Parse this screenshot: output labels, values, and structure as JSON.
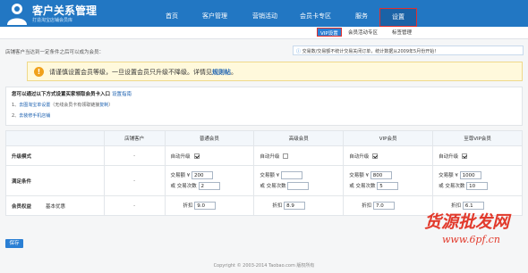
{
  "brand": {
    "title": "客户关系管理",
    "subtitle": "打造淘宝店铺会员库"
  },
  "nav": {
    "items": [
      "首页",
      "客户管理",
      "营销活动",
      "会员卡专区",
      "服务",
      "设置"
    ]
  },
  "subnav": {
    "items": [
      "VIP设置",
      "会员活动专区",
      "标签管理"
    ]
  },
  "intro": "店铺客户当达到一定条件之后可以成为会员：",
  "notice": {
    "text": "交易数/交易额不统计交易关闭订单，统计数据从2009年5月份开始！",
    "link": ""
  },
  "warning": {
    "text": "请谨慎设置会员等级，一旦设置会员只升级不降级。详情见",
    "link": "规则帖",
    "tail": "。"
  },
  "guide": {
    "title": "您可以通过以下方式设置买家领取会员卡入口",
    "title_link": "设置指南",
    "step1_prefix": "1、",
    "step1_link": "去图淘宝单设置",
    "step1_text": "（无线会员卡有领取链接",
    "step1_copy": "复制",
    "step1_close": "）",
    "step2_prefix": "2、",
    "step2_link": "去装修手机店铺"
  },
  "table": {
    "headers": [
      "",
      "店铺客户",
      "普通会员",
      "高级会员",
      "VIP会员",
      "至尊VIP会员"
    ],
    "row1_label": "升级模式",
    "row2_label": "满足条件",
    "row3_label": "会员权益",
    "row3_sub": "基本优惠",
    "dash": "-",
    "auto_upgrade": "自动升级",
    "amount_label": "交易额 ¥",
    "or": "或",
    "count_label": "交易次数",
    "discount_label": "折扣",
    "levels": [
      {
        "amount": "200",
        "count": "2",
        "discount": "9.0",
        "checked": true
      },
      {
        "amount": "",
        "count": "",
        "discount": "8.9",
        "checked": false
      },
      {
        "amount": "800",
        "count": "5",
        "discount": "7.0",
        "checked": true
      },
      {
        "amount": "1000",
        "count": "10",
        "discount": "6.1",
        "checked": true
      }
    ]
  },
  "save_label": "保存",
  "footer": "Copyright © 2003-2014 Taobao.com 版权所有",
  "watermark": {
    "text": "货源批发网",
    "url": "www.6pf.cn"
  },
  "colors": {
    "topbar": "#2277c3",
    "accent": "#2a7fd4",
    "highlight": "#e0302e",
    "warning_bg": "#fff9dc"
  }
}
